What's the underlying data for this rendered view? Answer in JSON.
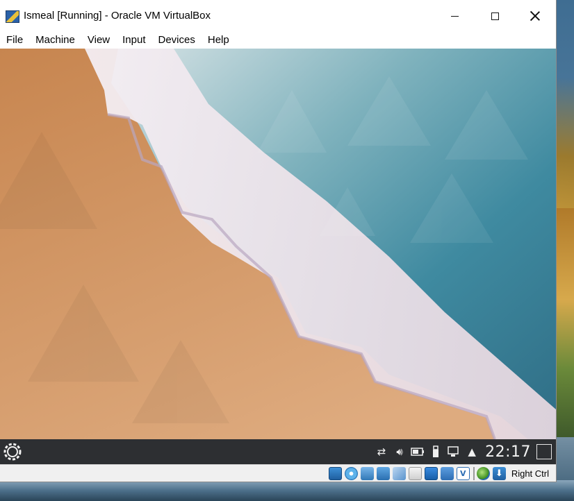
{
  "window": {
    "title": "Ismeal [Running] - Oracle VM VirtualBox"
  },
  "menubar": {
    "items": [
      "File",
      "Machine",
      "View",
      "Input",
      "Devices",
      "Help"
    ]
  },
  "guest": {
    "clock": "22:17",
    "tray_icons": [
      "network-icon",
      "volume-icon",
      "battery-icon",
      "usb-icon",
      "clipboard-icon",
      "expand-tray-icon"
    ]
  },
  "statusbar": {
    "host_key": "Right Ctrl",
    "icons": [
      "hard-disk-icon",
      "optical-drive-icon",
      "audio-icon",
      "network-adapter-icon",
      "usb-icon",
      "shared-folders-icon",
      "display-icon",
      "recording-icon",
      "vtx-icon",
      "mouse-integration-icon",
      "keyboard-capture-icon"
    ]
  },
  "colors": {
    "panel": "#2d2f32",
    "sand": "#d39a66",
    "sea": "#3f8aa0",
    "foam": "#efe3ea"
  }
}
